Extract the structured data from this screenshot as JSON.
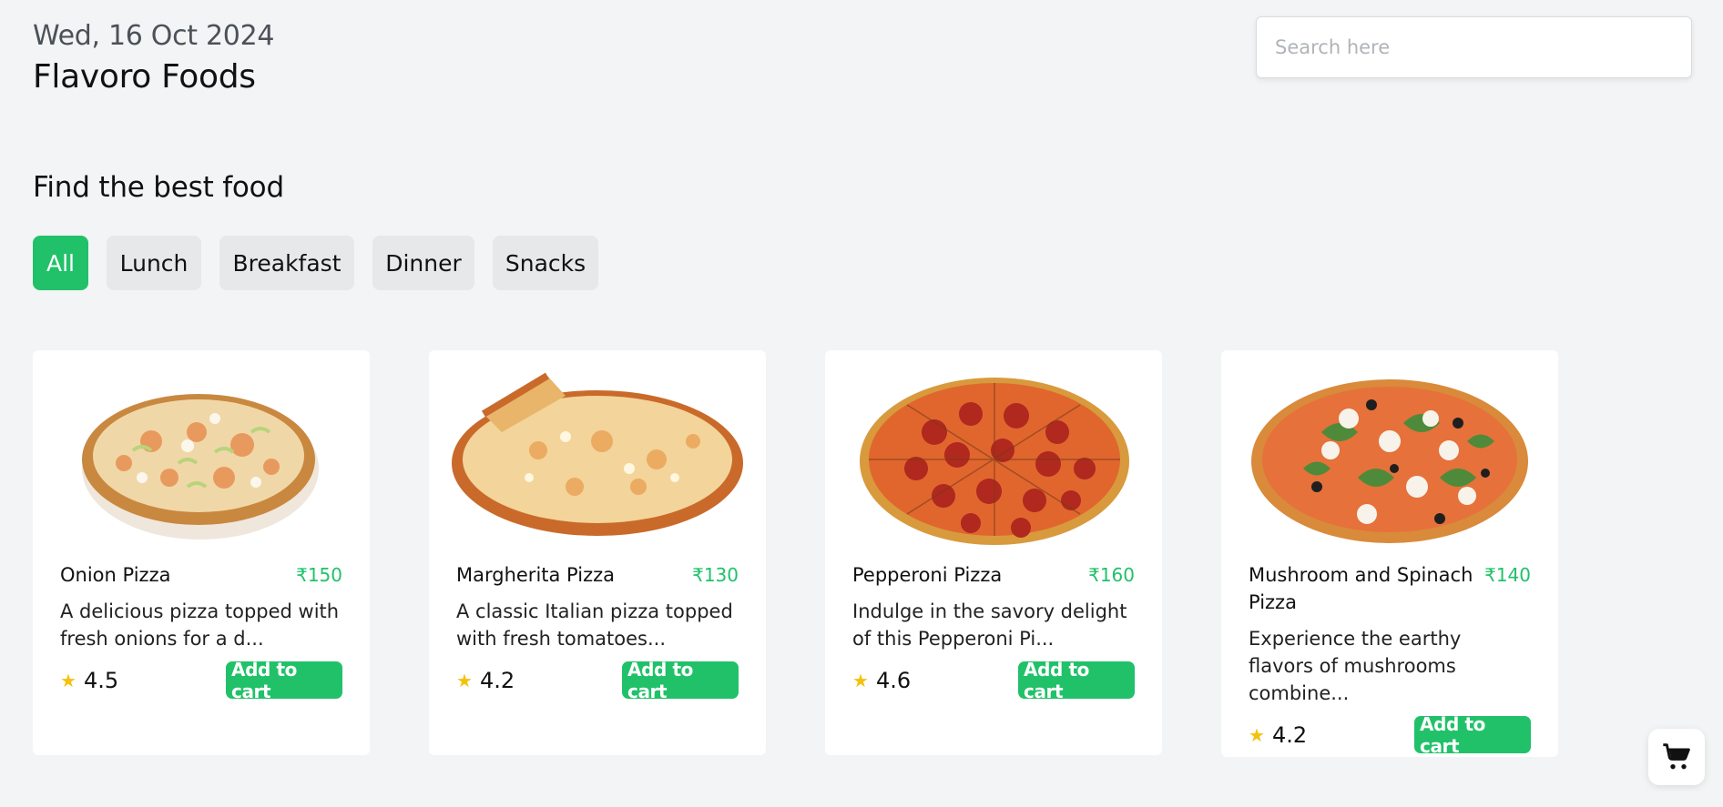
{
  "header": {
    "date": "Wed, 16 Oct 2024",
    "brand": "Flavoro Foods"
  },
  "search": {
    "placeholder": "Search here",
    "value": ""
  },
  "section": {
    "title": "Find the best food"
  },
  "tabs": [
    {
      "label": "All",
      "active": true
    },
    {
      "label": "Lunch",
      "active": false
    },
    {
      "label": "Breakfast",
      "active": false
    },
    {
      "label": "Dinner",
      "active": false
    },
    {
      "label": "Snacks",
      "active": false
    }
  ],
  "products": [
    {
      "name": "Onion Pizza",
      "price": "₹150",
      "description": "A delicious pizza topped with fresh onions for a d...",
      "rating": "4.5",
      "button": "Add to cart",
      "image": "onion-pizza"
    },
    {
      "name": "Margherita Pizza",
      "price": "₹130",
      "description": "A classic Italian pizza topped with fresh tomatoes...",
      "rating": "4.2",
      "button": "Add to cart",
      "image": "margherita-pizza"
    },
    {
      "name": "Pepperoni Pizza",
      "price": "₹160",
      "description": "Indulge in the savory delight of this Pepperoni Pi...",
      "rating": "4.6",
      "button": "Add to cart",
      "image": "pepperoni-pizza"
    },
    {
      "name": "Mushroom and Spinach Pizza",
      "price": "₹140",
      "description": "Experience the earthy flavors of mushrooms combine...",
      "rating": "4.2",
      "button": "Add to cart",
      "image": "mushroom-spinach-pizza"
    }
  ],
  "icons": {
    "star": "star-icon",
    "cart": "shopping-cart-icon"
  },
  "colors": {
    "accent": "#21c169",
    "star": "#f4c20d",
    "background": "#f3f4f5"
  }
}
